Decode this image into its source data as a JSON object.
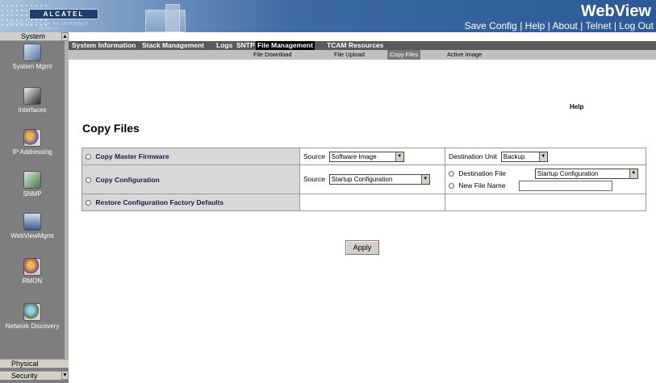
{
  "banner": {
    "logo_text": "ALCATEL",
    "tagline": "ARCHITECTS OF AN INTERNET WORLD",
    "app_name": "WebView",
    "links": [
      "Save Config",
      "Help",
      "About",
      "Telnet",
      "Log Out"
    ],
    "link_separator": "|"
  },
  "sidebar": {
    "header": "System",
    "items": [
      {
        "label": "System Mgmt",
        "icon": "system-mgmt-icon",
        "color": "#4a6fa5"
      },
      {
        "label": "Interfaces",
        "icon": "interfaces-icon",
        "color": "#3a3a3a"
      },
      {
        "label": "IP Addressing",
        "icon": "ip-addressing-icon",
        "color": "#6b4aa5"
      },
      {
        "label": "SNMP",
        "icon": "snmp-icon",
        "color": "#3f7a3f"
      },
      {
        "label": "WebViewMgmt",
        "icon": "webview-mgmt-icon",
        "color": "#3a5a8a"
      },
      {
        "label": "RMON",
        "icon": "rmon-icon",
        "color": "#8a3a8a"
      },
      {
        "label": "Network Discovery",
        "icon": "network-discovery-icon",
        "color": "#4a7a4a"
      }
    ],
    "footer_items": [
      "Physical",
      "Security"
    ]
  },
  "tabs": [
    {
      "label": "System Information",
      "active": false
    },
    {
      "label": "Stack Management",
      "active": false
    },
    {
      "label": "Logs",
      "active": false
    },
    {
      "label": "SNTP",
      "active": false
    },
    {
      "label": "File Management",
      "active": true
    },
    {
      "label": "TCAM Resources",
      "active": false
    }
  ],
  "subtabs": [
    {
      "label": "File Download",
      "active": false
    },
    {
      "label": "File Upload",
      "active": false
    },
    {
      "label": "Copy Files",
      "active": true
    },
    {
      "label": "Active Image",
      "active": false
    }
  ],
  "help_label": "Help",
  "page_title": "Copy Files",
  "form": {
    "rows": [
      {
        "option_label": "Copy Master Firmware",
        "source_label": "Source",
        "source_value": "Software Image",
        "dest_label": "Destination Unit",
        "dest_value": "Backup"
      },
      {
        "option_label": "Copy Configuration",
        "source_label": "Source",
        "source_value": "Startup Configuration",
        "dest_file_label": "Destination File",
        "dest_file_value": "Startup Configuration",
        "new_file_label": "New File Name",
        "new_file_value": ""
      },
      {
        "option_label": "Restore Configuration Factory Defaults"
      }
    ],
    "apply_label": "Apply"
  },
  "colors": {
    "banner": "#2b5a97",
    "sidebar": "#7e7e7e",
    "tab_bar": "#5a5a5a",
    "option_label": "#1a1a4e"
  }
}
